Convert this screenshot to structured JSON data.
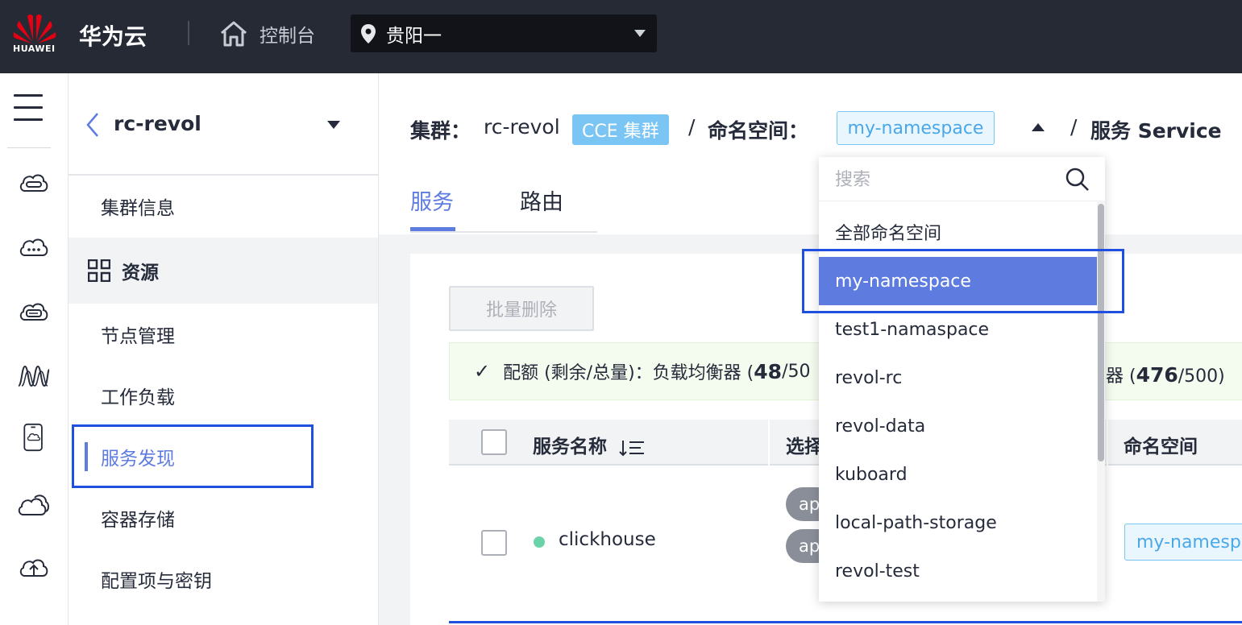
{
  "topbar": {
    "logo_text": "HUAWEI",
    "brand": "华为云",
    "console_label": "控制台",
    "region": "贵阳一"
  },
  "submenu": {
    "cluster_name": "rc-revol",
    "items": [
      {
        "label": "集群信息"
      },
      {
        "label": "资源"
      },
      {
        "label": "节点管理"
      },
      {
        "label": "工作负载"
      },
      {
        "label": "服务发现"
      },
      {
        "label": "容器存储"
      },
      {
        "label": "配置项与密钥"
      }
    ]
  },
  "breadcrumb": {
    "cluster_label": "集群：",
    "cluster_value": "rc-revol",
    "cluster_tag": "CCE 集群",
    "sep1": "/",
    "namespace_label": "命名空间：",
    "namespace_value": "my-namespace",
    "sep2": "/",
    "page_title": "服务 Service"
  },
  "tabs": [
    {
      "label": "服务"
    },
    {
      "label": "路由"
    }
  ],
  "toolbar": {
    "batch_delete_label": "批量删除"
  },
  "quota": {
    "check": "✓",
    "prefix": "配额 (剩余/总量)：负载均衡器 (",
    "lb_remaining": "48",
    "lb_rest": "/50",
    "tail_prefix": "器 (",
    "tail_remaining": "476",
    "tail_rest": "/500)"
  },
  "table": {
    "columns": [
      "服务名称",
      "选择",
      "命名空间"
    ],
    "rows": [
      {
        "name": "clickhouse",
        "selector_pills": [
          "ap",
          "ap"
        ],
        "namespace": "my-namespa"
      }
    ]
  },
  "dropdown": {
    "search_placeholder": "搜索",
    "options": [
      {
        "label": "全部命名空间"
      },
      {
        "label": "my-namespace"
      },
      {
        "label": "test1-namaspace"
      },
      {
        "label": "revol-rc"
      },
      {
        "label": "revol-data"
      },
      {
        "label": "kuboard"
      },
      {
        "label": "local-path-storage"
      },
      {
        "label": "revol-test"
      }
    ],
    "selected_index": 1
  },
  "colors": {
    "topbar_bg": "#252a34",
    "accent": "#5e7ce0",
    "cce_tag": "#7ac5f3",
    "highlight_box": "#1f4fe0",
    "status_running": "#6cd2a8",
    "huawei_red": "#e60012"
  }
}
